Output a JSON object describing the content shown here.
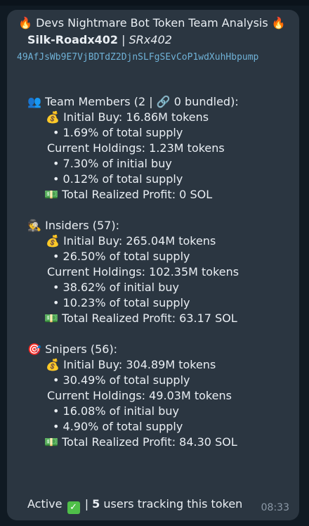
{
  "header": {
    "title": "Devs Nightmare Bot Token Team Analysis",
    "name": "Silk-Roadx402",
    "separator": "|",
    "ticker": "SRx402",
    "address": "49AfJsWb9E7VjBDTdZ2DjnSLFgSEvCoP1wdXuhHbpump"
  },
  "icons": {
    "fire": "🔥",
    "team": "👥",
    "link": "🔗",
    "money_bag": "💰",
    "cash": "💵",
    "detective": "🕵️",
    "target": "🎯"
  },
  "team": {
    "heading": "Team Members (2 | ",
    "heading_tail": " 0 bundled):",
    "initial_buy": "Initial Buy: 16.86M tokens",
    "initial_pct": "• 1.69% of total supply",
    "holdings": "Current Holdings: 1.23M tokens",
    "holdings_pct_initial": "• 7.30% of initial buy",
    "holdings_pct_supply": "• 0.12% of total supply",
    "profit": "Total Realized Profit: 0 SOL"
  },
  "insiders": {
    "heading": "Insiders (57):",
    "initial_buy": "Initial Buy: 265.04M tokens",
    "initial_pct": "• 26.50% of total supply",
    "holdings": "Current Holdings: 102.35M tokens",
    "holdings_pct_initial": "• 38.62% of initial buy",
    "holdings_pct_supply": "• 10.23% of total supply",
    "profit": "Total Realized Profit: 63.17 SOL"
  },
  "snipers": {
    "heading": "Snipers (56):",
    "initial_buy": "Initial Buy: 304.89M tokens",
    "initial_pct": "• 30.49% of total supply",
    "holdings": "Current Holdings: 49.03M tokens",
    "holdings_pct_initial": "• 16.08% of initial buy",
    "holdings_pct_supply": "• 4.90% of total supply",
    "profit": "Total Realized Profit: 84.30 SOL"
  },
  "footer": {
    "status": "Active",
    "check": "✓",
    "separator": "|",
    "count": "5",
    "tracking": "users tracking this token",
    "time": "08:33"
  }
}
